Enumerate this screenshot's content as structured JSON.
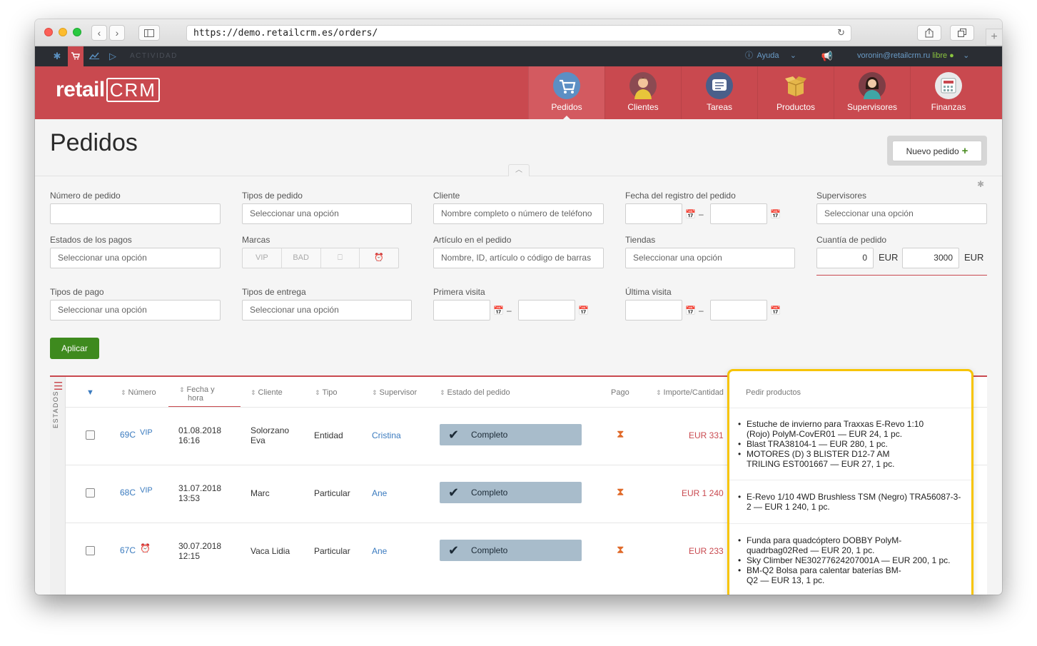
{
  "browser": {
    "url": "https://demo.retailcrm.es/orders/"
  },
  "topbar": {
    "activity_label": "ACTIVIDAD",
    "help_label": "Ayuda",
    "user_email": "voronin@retailcrm.ru",
    "user_status": "libre"
  },
  "nav": {
    "logo": "retailCRM",
    "items": [
      {
        "label": "Pedidos"
      },
      {
        "label": "Clientes"
      },
      {
        "label": "Tareas"
      },
      {
        "label": "Productos"
      },
      {
        "label": "Supervisores"
      },
      {
        "label": "Finanzas"
      }
    ]
  },
  "page": {
    "title": "Pedidos",
    "new_order_label": "Nuevo pedido"
  },
  "filters": {
    "numero_label": "Número de pedido",
    "tipos_label": "Tipos de pedido",
    "tipos_placeholder": "Seleccionar una opción",
    "cliente_label": "Cliente",
    "cliente_placeholder": "Nombre completo o número de teléfono",
    "fecha_label": "Fecha del registro del pedido",
    "supervisores_label": "Supervisores",
    "supervisores_placeholder": "Seleccionar una opción",
    "estados_pagos_label": "Estados de los pagos",
    "estados_pagos_placeholder": "Seleccionar una opción",
    "marcas_label": "Marcas",
    "marcas_vip": "VIP",
    "marcas_bad": "BAD",
    "articulo_label": "Artículo en el pedido",
    "articulo_placeholder": "Nombre, ID, artículo o código de barras",
    "tiendas_label": "Tiendas",
    "tiendas_placeholder": "Seleccionar una opción",
    "cuantia_label": "Cuantía de pedido",
    "cuantia_min": "0",
    "cuantia_max": "3000",
    "currency": "EUR",
    "tipos_pago_label": "Tipos de pago",
    "tipos_pago_placeholder": "Seleccionar una opción",
    "tipos_entrega_label": "Tipos de entrega",
    "tipos_entrega_placeholder": "Seleccionar una opción",
    "primera_visita_label": "Primera visita",
    "ultima_visita_label": "Última visita",
    "date_separator": "–",
    "apply_label": "Aplicar"
  },
  "table": {
    "states_label": "ESTADOS",
    "headers": {
      "numero": "Número",
      "fecha_1": "Fecha y",
      "fecha_2": "hora",
      "cliente": "Cliente",
      "tipo": "Tipo",
      "supervisor": "Supervisor",
      "estado": "Estado del pedido",
      "pago": "Pago",
      "importe": "Importe/Cantidad"
    },
    "rows": [
      {
        "number": "69C",
        "mark": "VIP",
        "date": "01.08.2018",
        "time": "16:16",
        "client_1": "Solorzano",
        "client_2": "Eva",
        "type": "Entidad",
        "supervisor": "Cristina",
        "status": "Completo",
        "amount": "EUR 331"
      },
      {
        "number": "68C",
        "mark": "VIP",
        "date": "31.07.2018",
        "time": "13:53",
        "client_1": "Marc",
        "client_2": "",
        "type": "Particular",
        "supervisor": "Ane",
        "status": "Completo",
        "amount": "EUR 1 240"
      },
      {
        "number": "67C",
        "mark": "",
        "date": "30.07.2018",
        "time": "12:15",
        "client_1": "Vaca Lidia",
        "client_2": "",
        "type": "Particular",
        "supervisor": "Ane",
        "status": "Completo",
        "amount": "EUR 233"
      }
    ]
  },
  "popup": {
    "title": "Pedir productos",
    "groups": [
      [
        [
          "Estuche de invierno para Traxxas E-Revo 1:10",
          "(Rojo) PolyM-CovER01 — EUR 24, 1 pc."
        ],
        [
          "Blast TRA38104-1 — EUR 280, 1 pc."
        ],
        [
          "MOTORES (D) 3 BLISTER D12-7 AM",
          "TRILING EST001667 — EUR 27, 1 pc."
        ]
      ],
      [
        [
          "E-Revo 1/10 4WD Brushless TSM (Negro) TRA56087-3-",
          "2 — EUR 1 240, 1 pc."
        ]
      ],
      [
        [
          "Funda para quadcóptero DOBBY PolyM-",
          "quadrbag02Red — EUR 20, 1 pc."
        ],
        [
          "Sky Climber NE30277624207001A — EUR 200, 1 pc."
        ],
        [
          "BM-Q2 Bolsa para calentar baterías BM-",
          "Q2 — EUR 13, 1 pc."
        ]
      ]
    ]
  }
}
